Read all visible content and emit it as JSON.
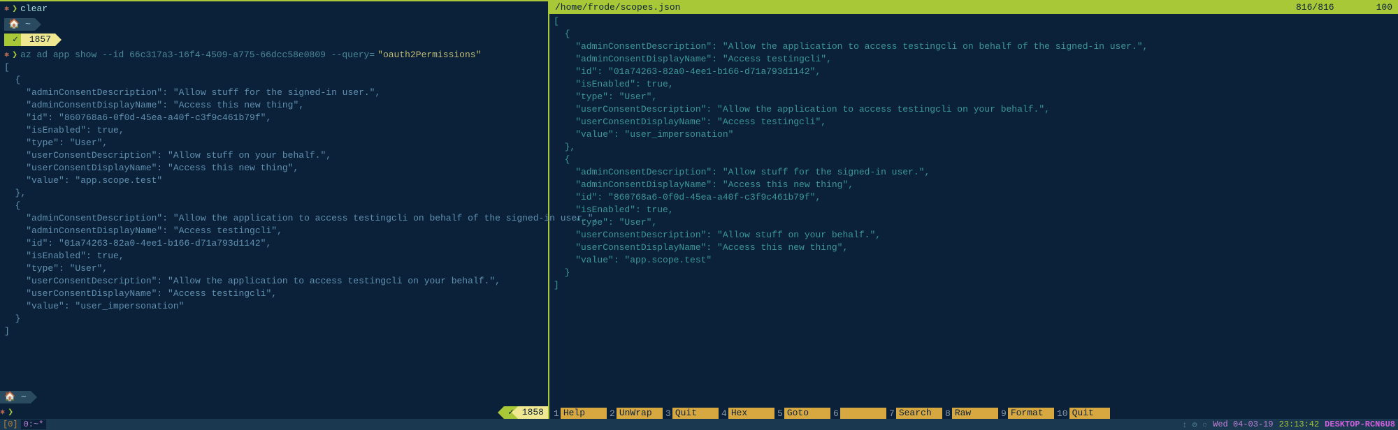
{
  "left": {
    "line1_cmd": "clear",
    "home_tilde": "~",
    "hist1": "1857",
    "cmd_prefix": "az ad app show --id 66c317a3-16f4-4509-a775-66dcc58e0809 --query=",
    "cmd_quoted": "\"oauth2Permissions\"",
    "json": "[\n  {\n    \"adminConsentDescription\": \"Allow stuff for the signed-in user.\",\n    \"adminConsentDisplayName\": \"Access this new thing\",\n    \"id\": \"860768a6-0f0d-45ea-a40f-c3f9c461b79f\",\n    \"isEnabled\": true,\n    \"type\": \"User\",\n    \"userConsentDescription\": \"Allow stuff on your behalf.\",\n    \"userConsentDisplayName\": \"Access this new thing\",\n    \"value\": \"app.scope.test\"\n  },\n  {\n    \"adminConsentDescription\": \"Allow the application to access testingcli on behalf of the signed-in user.\",\n    \"adminConsentDisplayName\": \"Access testingcli\",\n    \"id\": \"01a74263-82a0-4ee1-b166-d71a793d1142\",\n    \"isEnabled\": true,\n    \"type\": \"User\",\n    \"userConsentDescription\": \"Allow the application to access testingcli on your behalf.\",\n    \"userConsentDisplayName\": \"Access testingcli\",\n    \"value\": \"user_impersonation\"\n  }\n]",
    "hist2": "1858",
    "check": "✓"
  },
  "right": {
    "path": "/home/frode/scopes.json",
    "pos": "816/816",
    "pct": "100",
    "json": "[\n  {\n    \"adminConsentDescription\": \"Allow the application to access testingcli on behalf of the signed-in user.\",\n    \"adminConsentDisplayName\": \"Access testingcli\",\n    \"id\": \"01a74263-82a0-4ee1-b166-d71a793d1142\",\n    \"isEnabled\": true,\n    \"type\": \"User\",\n    \"userConsentDescription\": \"Allow the application to access testingcli on your behalf.\",\n    \"userConsentDisplayName\": \"Access testingcli\",\n    \"value\": \"user_impersonation\"\n  },\n  {\n    \"adminConsentDescription\": \"Allow stuff for the signed-in user.\",\n    \"adminConsentDisplayName\": \"Access this new thing\",\n    \"id\": \"860768a6-0f0d-45ea-a40f-c3f9c461b79f\",\n    \"isEnabled\": true,\n    \"type\": \"User\",\n    \"userConsentDescription\": \"Allow stuff on your behalf.\",\n    \"userConsentDisplayName\": \"Access this new thing\",\n    \"value\": \"app.scope.test\"\n  }\n]",
    "fn": [
      {
        "n": "1",
        "label": "Help"
      },
      {
        "n": "2",
        "label": "UnWrap"
      },
      {
        "n": "3",
        "label": "Quit"
      },
      {
        "n": "4",
        "label": "Hex"
      },
      {
        "n": "5",
        "label": "Goto"
      },
      {
        "n": "6",
        "label": ""
      },
      {
        "n": "7",
        "label": "Search"
      },
      {
        "n": "8",
        "label": "Raw"
      },
      {
        "n": "9",
        "label": "Format"
      },
      {
        "n": "10",
        "label": "Quit"
      }
    ]
  },
  "bottombar": {
    "left": "[0]",
    "tab": "0:~*",
    "icons": "↕ ⚙ ○",
    "date": "Wed 04-03-19",
    "time": "23:13:42",
    "host": "DESKTOP-RCN6U8"
  }
}
